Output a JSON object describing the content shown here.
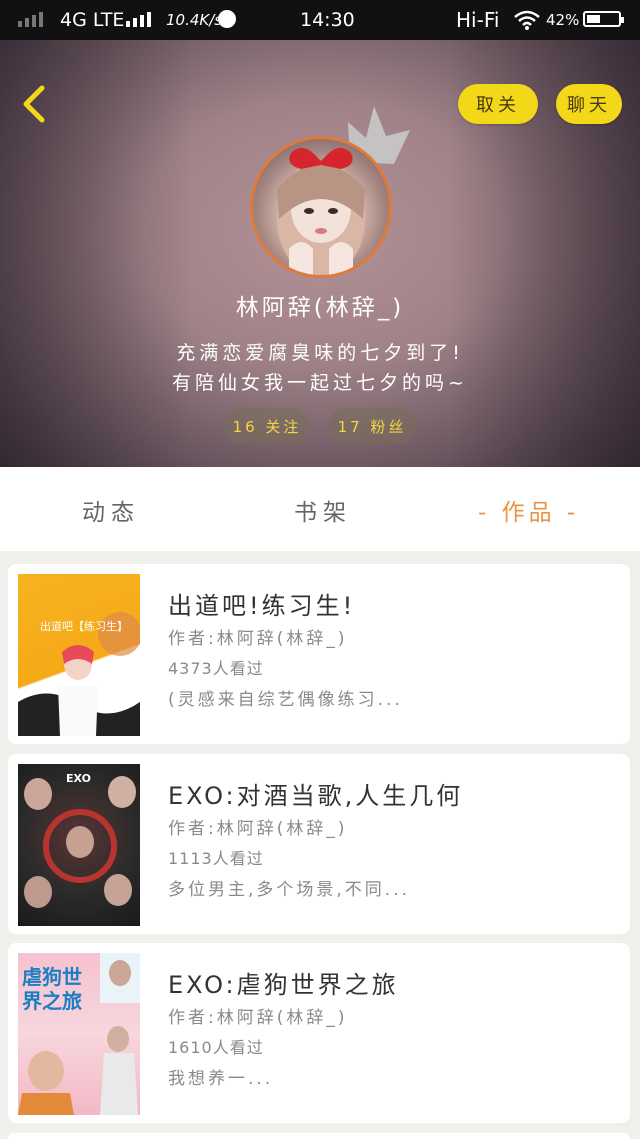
{
  "status_bar": {
    "network": "4G LTE",
    "speed": "10.4K/s",
    "time": "14:30",
    "audio": "Hi-Fi",
    "battery": "42%",
    "battery_level": 0.42
  },
  "profile": {
    "unfollow_label": "取关",
    "chat_label": "聊天",
    "username": "林阿辞(林辞_)",
    "bio_line1": "充满恋爱腐臭味的七夕到了!",
    "bio_line2": "有陪仙女我一起过七夕的吗~",
    "following": "16 关注",
    "fans": "17 粉丝"
  },
  "tabs": {
    "dynamics": "动态",
    "bookshelf": "书架",
    "works": "- 作品 -"
  },
  "works": [
    {
      "title": "出道吧!练习生!",
      "author": "作者:林阿辞(林辞_)",
      "views": "4373人看过",
      "desc": "(灵感来自综艺偶像练习...",
      "cover_text": "出道吧【练习生】"
    },
    {
      "title": "EXO:对酒当歌,人生几何",
      "author": "作者:林阿辞(林辞_)",
      "views": "1113人看过",
      "desc": "多位男主,多个场景,不同...",
      "cover_text": "EXO"
    },
    {
      "title": "EXO:虐狗世界之旅",
      "author": "作者:林阿辞(林辞_)",
      "views": "1610人看过",
      "desc": "我想养一...",
      "cover_text": "虐狗世界之旅"
    }
  ],
  "colors": {
    "accent_yellow": "#f3d81a",
    "tab_active": "#e89442",
    "avatar_border": "#e07a3a"
  }
}
